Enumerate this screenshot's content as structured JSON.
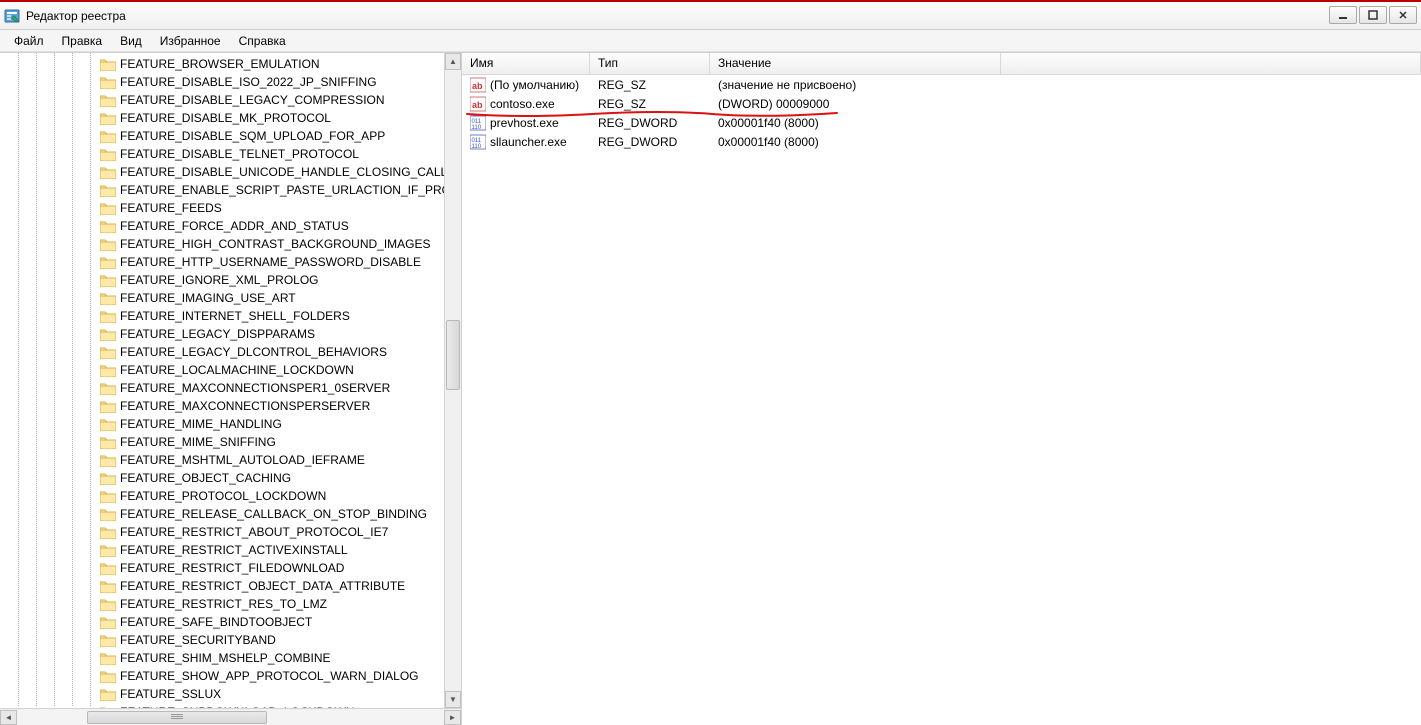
{
  "window": {
    "title": "Редактор реестра"
  },
  "menu": {
    "items": [
      "Файл",
      "Правка",
      "Вид",
      "Избранное",
      "Справка"
    ]
  },
  "tree": {
    "items": [
      "FEATURE_BROWSER_EMULATION",
      "FEATURE_DISABLE_ISO_2022_JP_SNIFFING",
      "FEATURE_DISABLE_LEGACY_COMPRESSION",
      "FEATURE_DISABLE_MK_PROTOCOL",
      "FEATURE_DISABLE_SQM_UPLOAD_FOR_APP",
      "FEATURE_DISABLE_TELNET_PROTOCOL",
      "FEATURE_DISABLE_UNICODE_HANDLE_CLOSING_CALLBACK",
      "FEATURE_ENABLE_SCRIPT_PASTE_URLACTION_IF_PROMPT",
      "FEATURE_FEEDS",
      "FEATURE_FORCE_ADDR_AND_STATUS",
      "FEATURE_HIGH_CONTRAST_BACKGROUND_IMAGES",
      "FEATURE_HTTP_USERNAME_PASSWORD_DISABLE",
      "FEATURE_IGNORE_XML_PROLOG",
      "FEATURE_IMAGING_USE_ART",
      "FEATURE_INTERNET_SHELL_FOLDERS",
      "FEATURE_LEGACY_DISPPARAMS",
      "FEATURE_LEGACY_DLCONTROL_BEHAVIORS",
      "FEATURE_LOCALMACHINE_LOCKDOWN",
      "FEATURE_MAXCONNECTIONSPER1_0SERVER",
      "FEATURE_MAXCONNECTIONSPERSERVER",
      "FEATURE_MIME_HANDLING",
      "FEATURE_MIME_SNIFFING",
      "FEATURE_MSHTML_AUTOLOAD_IEFRAME",
      "FEATURE_OBJECT_CACHING",
      "FEATURE_PROTOCOL_LOCKDOWN",
      "FEATURE_RELEASE_CALLBACK_ON_STOP_BINDING",
      "FEATURE_RESTRICT_ABOUT_PROTOCOL_IE7",
      "FEATURE_RESTRICT_ACTIVEXINSTALL",
      "FEATURE_RESTRICT_FILEDOWNLOAD",
      "FEATURE_RESTRICT_OBJECT_DATA_ATTRIBUTE",
      "FEATURE_RESTRICT_RES_TO_LMZ",
      "FEATURE_SAFE_BINDTOOBJECT",
      "FEATURE_SECURITYBAND",
      "FEATURE_SHIM_MSHELP_COMBINE",
      "FEATURE_SHOW_APP_PROTOCOL_WARN_DIALOG",
      "FEATURE_SSLUX",
      "FEATURE_SUBDOWNLOAD_LOCKDOWN"
    ]
  },
  "list": {
    "columns": {
      "name": "Имя",
      "type": "Тип",
      "value": "Значение"
    },
    "rows": [
      {
        "icon": "sz",
        "name": "(По умолчанию)",
        "type": "REG_SZ",
        "value": "(значение не присвоено)"
      },
      {
        "icon": "sz",
        "name": "contoso.exe",
        "type": "REG_SZ",
        "value": "(DWORD) 00009000"
      },
      {
        "icon": "dword",
        "name": "prevhost.exe",
        "type": "REG_DWORD",
        "value": "0x00001f40 (8000)"
      },
      {
        "icon": "dword",
        "name": "sllauncher.exe",
        "type": "REG_DWORD",
        "value": "0x00001f40 (8000)"
      }
    ]
  }
}
